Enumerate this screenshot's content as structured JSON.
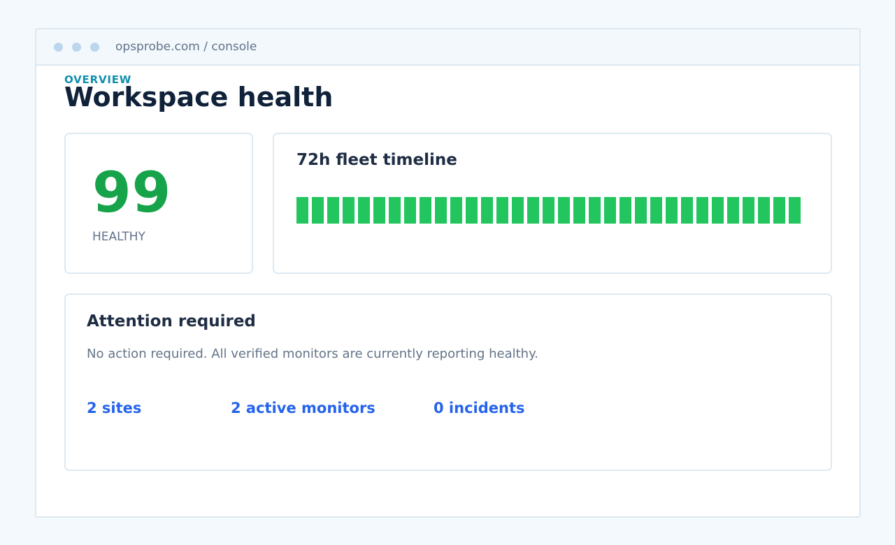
{
  "window": {
    "address": "opsprobe.com / console"
  },
  "header": {
    "eyebrow": "OVERVIEW",
    "title": "Workspace health"
  },
  "score": {
    "value": "99",
    "label": "HEALTHY",
    "color": "#16a34a"
  },
  "timeline": {
    "title": "72h fleet timeline",
    "segment_count": 33,
    "segments_status": [
      "healthy",
      "healthy",
      "healthy",
      "healthy",
      "healthy",
      "healthy",
      "healthy",
      "healthy",
      "healthy",
      "healthy",
      "healthy",
      "healthy",
      "healthy",
      "healthy",
      "healthy",
      "healthy",
      "healthy",
      "healthy",
      "healthy",
      "healthy",
      "healthy",
      "healthy",
      "healthy",
      "healthy",
      "healthy",
      "healthy",
      "healthy",
      "healthy",
      "healthy",
      "healthy",
      "healthy",
      "healthy",
      "healthy"
    ],
    "status_colors": {
      "healthy": "#22c55e"
    }
  },
  "attention": {
    "title": "Attention required",
    "message": "No action required. All verified monitors are currently reporting healthy.",
    "stats": {
      "sites": "2 sites",
      "monitors": "2 active monitors",
      "incidents": "0 incidents"
    }
  }
}
